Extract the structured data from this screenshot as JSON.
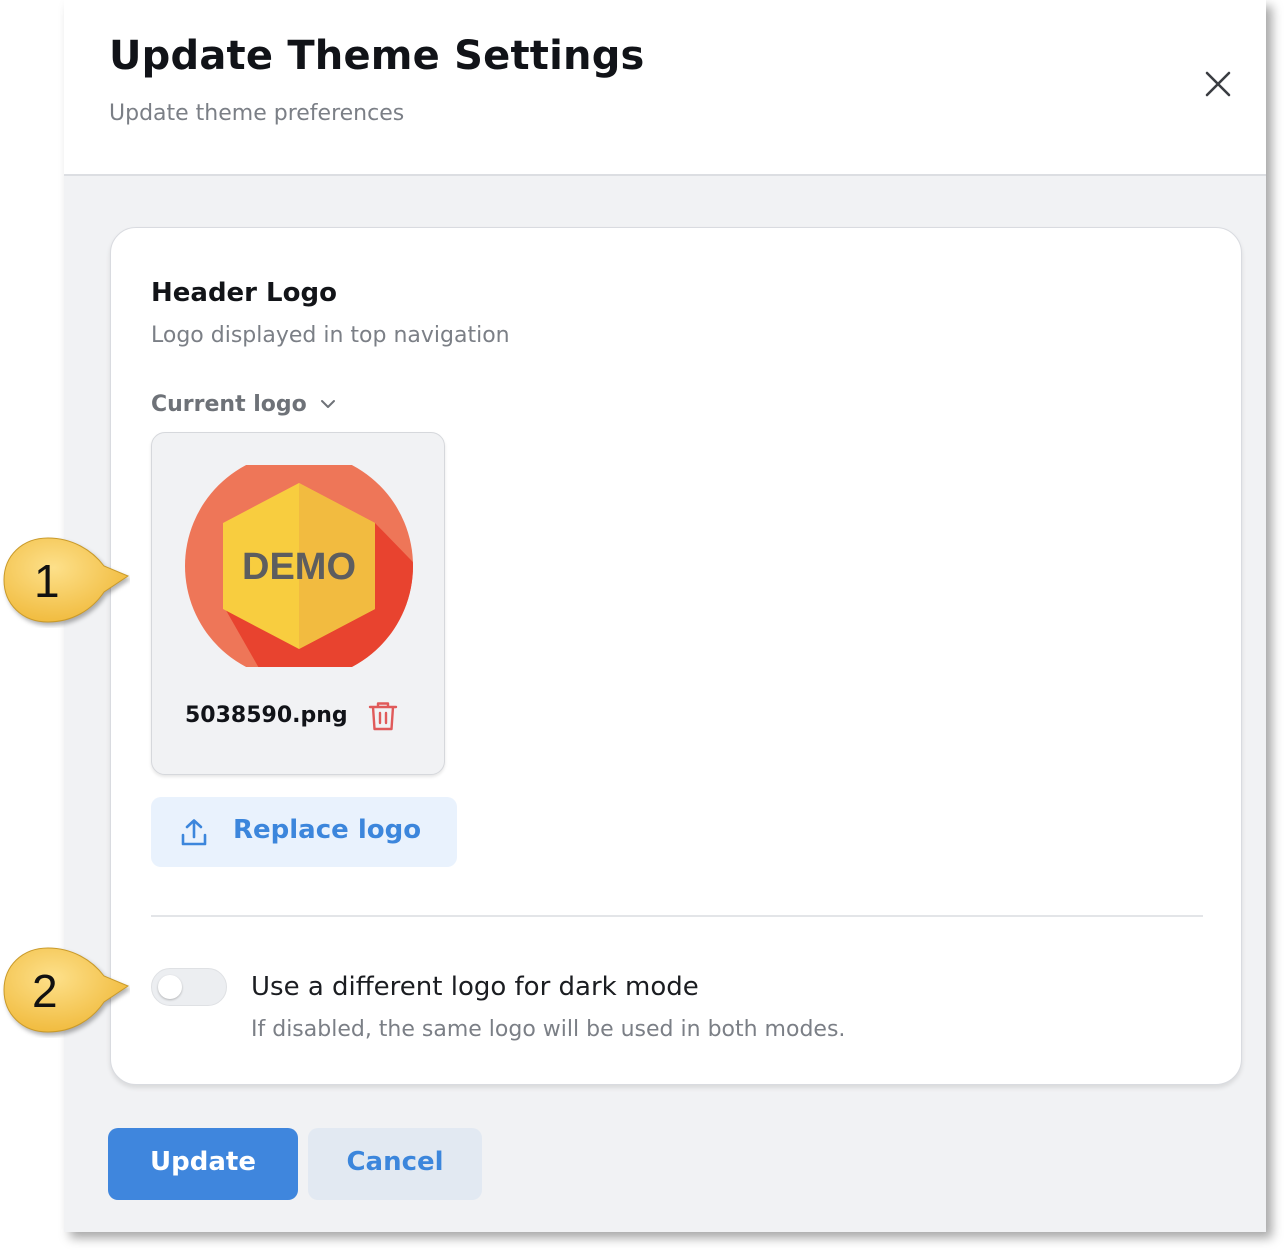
{
  "dialog": {
    "title": "Update Theme Settings",
    "subtitle": "Update theme preferences",
    "close_icon": "close-icon"
  },
  "header_logo": {
    "title": "Header Logo",
    "description": "Logo displayed in top navigation",
    "current_logo_label": "Current logo",
    "logo_text": "DEMO",
    "file_name": "5038590.png",
    "replace_label": "Replace logo"
  },
  "dark_mode": {
    "toggle_enabled": false,
    "label": "Use a different logo for dark mode",
    "help": "If disabled, the same logo will be used in both modes."
  },
  "footer": {
    "update_label": "Update",
    "cancel_label": "Cancel"
  },
  "callouts": [
    "1",
    "2"
  ],
  "colors": {
    "accent": "#3f86dd",
    "danger": "#e05a5a",
    "callout": "#f5c74e"
  }
}
